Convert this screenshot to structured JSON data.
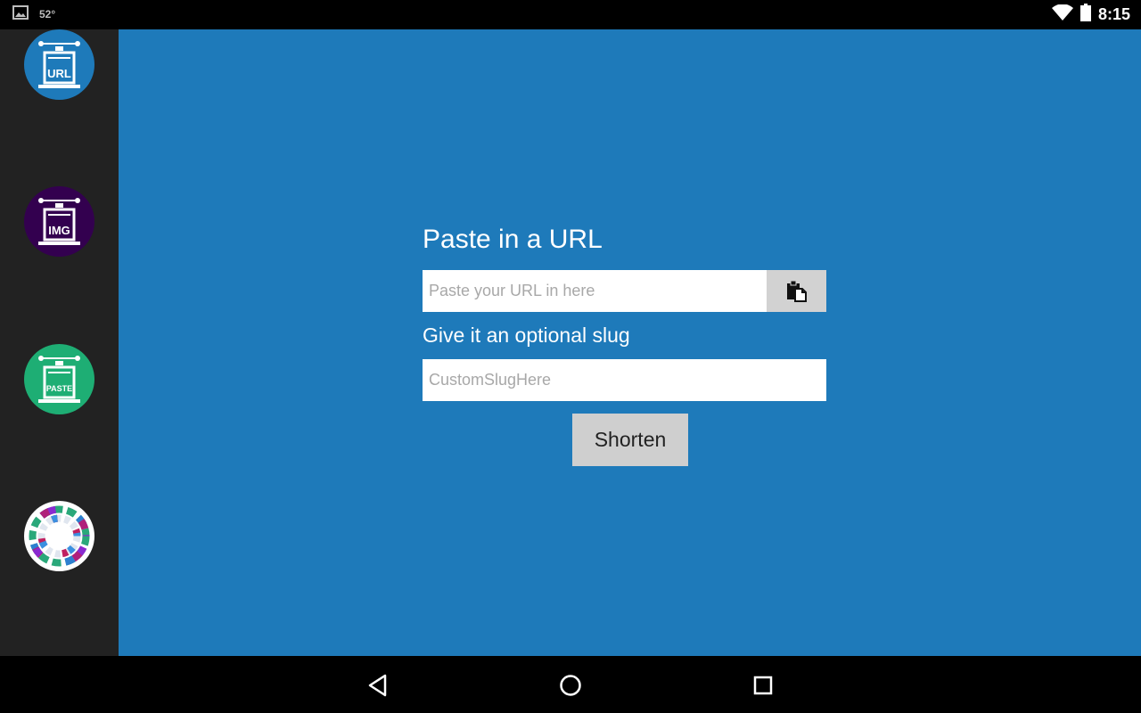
{
  "status_bar": {
    "temperature": "52°",
    "time": "8:15",
    "icons": [
      "image-icon",
      "wifi-icon",
      "battery-icon"
    ]
  },
  "sidebar": {
    "items": [
      {
        "label": "URL",
        "icon": "url-press-icon",
        "color": "#1e7aba"
      },
      {
        "label": "IMG",
        "icon": "img-press-icon",
        "color": "#33004f"
      },
      {
        "label": "PASTE",
        "icon": "paste-press-icon",
        "color": "#1eae74"
      },
      {
        "label": "",
        "icon": "color-wheel-icon",
        "color": "#ffffff"
      }
    ]
  },
  "main": {
    "background": "#1e7aba",
    "title": "Paste in a URL",
    "url_placeholder": "Paste your URL in here",
    "url_value": "",
    "paste_icon": "clipboard-paste-icon",
    "slug_label": "Give it an optional slug",
    "slug_placeholder": "CustomSlugHere",
    "slug_value": "",
    "shorten_label": "Shorten"
  },
  "nav_bar": {
    "buttons": [
      "back-icon",
      "home-icon",
      "recents-icon"
    ]
  }
}
